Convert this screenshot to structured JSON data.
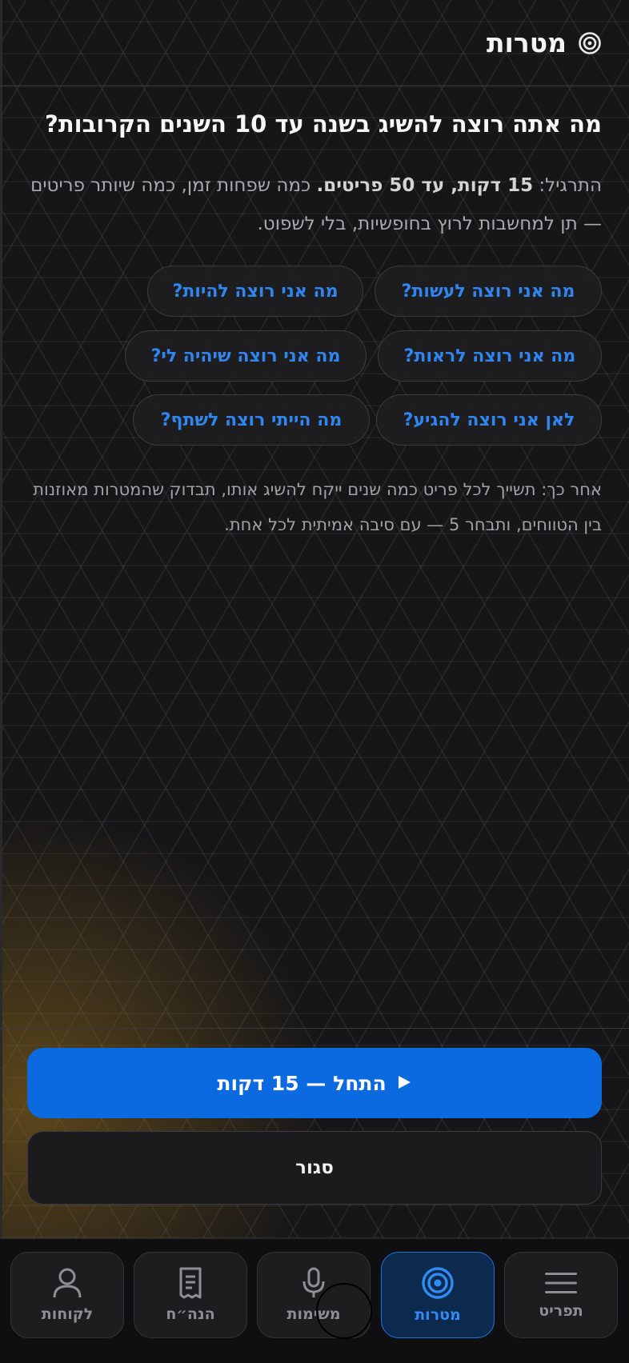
{
  "header": {
    "title": "מטרות",
    "icon": "target-icon"
  },
  "question": "מה אתה רוצה להשיג בשנה עד 10 השנים הקרובות?",
  "intro": {
    "prefix": "התרגיל: ",
    "bold": "15 דקות, עד 50 פריטים.",
    "rest": " כמה שפחות זמן, כמה שיותר פריטים — תן למחשבות לרוץ בחופשיות, בלי לשפוט."
  },
  "chips": [
    "מה אני רוצה לעשות?",
    "מה אני רוצה להיות?",
    "מה אני רוצה לראות?",
    "מה אני רוצה שיהיה לי?",
    "לאן אני רוצה להגיע?",
    "מה הייתי רוצה לשתף?"
  ],
  "note": "אחר כך: תשייך לכל פריט כמה שנים ייקח להשיג אותו, תבדוק שהמטרות מאוזנות בין הטווחים, ותבחר 5 — עם סיבה אמיתית לכל אחת.",
  "actions": {
    "start_label": "התחל — 15 דקות",
    "start_icon": "play-icon",
    "close_label": "סגור"
  },
  "tabs": [
    {
      "label": "תפריט",
      "icon": "menu-icon"
    },
    {
      "label": "מטרות",
      "icon": "target-icon",
      "active": true
    },
    {
      "label": "משימות",
      "icon": "microphone-icon"
    },
    {
      "label": "הנה״ח",
      "icon": "receipt-icon"
    },
    {
      "label": "לקוחות",
      "icon": "user-icon"
    }
  ],
  "colors": {
    "accent": "#0b6ae0",
    "chip_text": "#2f86f0",
    "background": "#161618"
  }
}
